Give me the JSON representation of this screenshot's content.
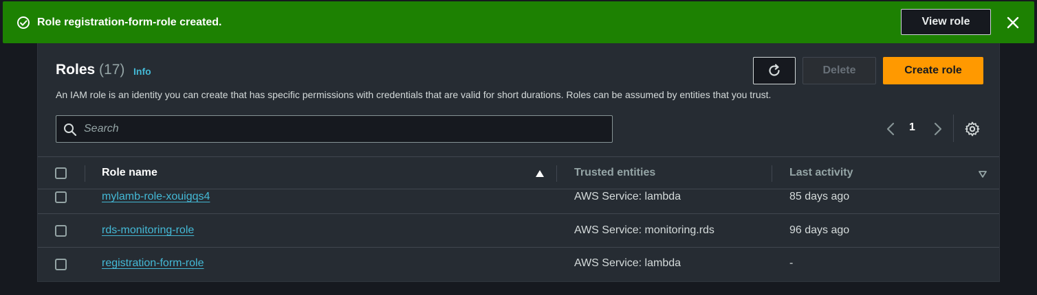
{
  "flash": {
    "message": "Role registration-form-role created.",
    "view_role_label": "View role",
    "icon": "check-circle-icon",
    "close_icon": "close-icon",
    "color": "#1d8102"
  },
  "header": {
    "title": "Roles",
    "count": "(17)",
    "info_label": "Info",
    "description": "An IAM role is an identity you can create that has specific permissions with credentials that are valid for short durations. Roles can be assumed by entities that you trust."
  },
  "actions": {
    "refresh_icon": "refresh-icon",
    "delete_label": "Delete",
    "create_label": "Create role",
    "accent": "#ff9900"
  },
  "search": {
    "placeholder": "Search",
    "value": ""
  },
  "pagination": {
    "current_page": "1"
  },
  "table": {
    "columns": [
      "Role name",
      "Trusted entities",
      "Last activity"
    ],
    "sort_column": "Role name",
    "sort_direction": "ascending",
    "rows": [
      {
        "role_name": "mylamb-role-xouigqs4",
        "trusted": "AWS Service: lambda",
        "last_activity": "85 days ago"
      },
      {
        "role_name": "rds-monitoring-role",
        "trusted": "AWS Service: monitoring.rds",
        "last_activity": "96 days ago"
      },
      {
        "role_name": "registration-form-role",
        "trusted": "AWS Service: lambda",
        "last_activity": "-"
      }
    ]
  }
}
